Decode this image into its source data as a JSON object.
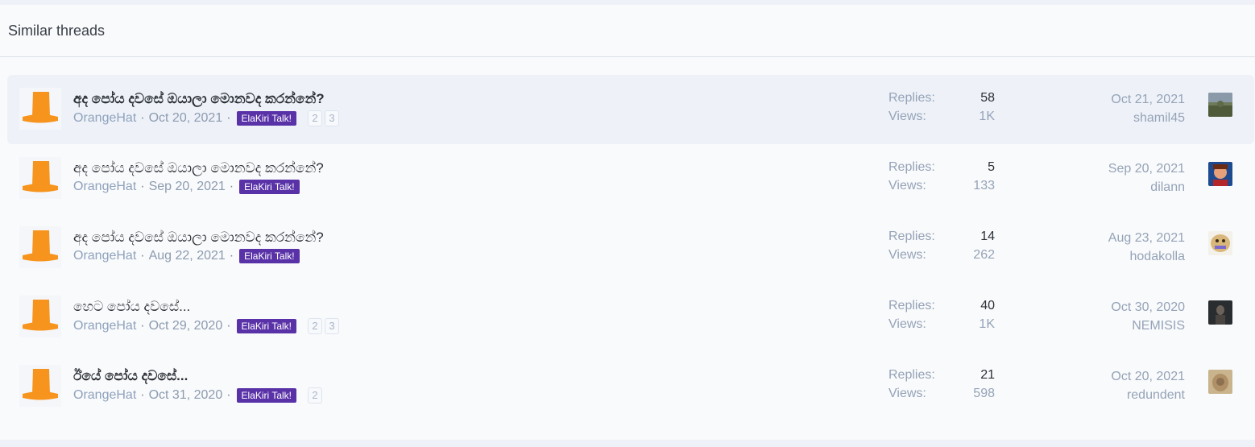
{
  "header": {
    "title": "Similar threads"
  },
  "labels": {
    "replies": "Replies:",
    "views": "Views:"
  },
  "colors": {
    "tag_bg": "#5a32a8",
    "hat": "#f7941d",
    "author": "#8fa2bd"
  },
  "threads": [
    {
      "title": "අද පෝය දවසේ ඔයාලා මොනවද කරන්නේ?",
      "author": "OrangeHat",
      "date": "Oct 20, 2021",
      "tag": "ElaKiri Talk!",
      "pages": [
        "2",
        "3"
      ],
      "replies": "58",
      "views": "1K",
      "last_date": "Oct 21, 2021",
      "last_user": "shamil45",
      "last_avatar_icon": "landscape-avatar"
    },
    {
      "title": "අද පෝය දවසේ ඔයාලා මොනවද කරන්නේ?",
      "author": "OrangeHat",
      "date": "Sep 20, 2021",
      "tag": "ElaKiri Talk!",
      "pages": [],
      "replies": "5",
      "views": "133",
      "last_date": "Sep 20, 2021",
      "last_user": "dilann",
      "last_avatar_icon": "cartoon-avatar"
    },
    {
      "title": "අද පෝය දවසේ ඔයාලා මොනවද කරන්නේ?",
      "author": "OrangeHat",
      "date": "Aug 22, 2021",
      "tag": "ElaKiri Talk!",
      "pages": [],
      "replies": "14",
      "views": "262",
      "last_date": "Aug 23, 2021",
      "last_user": "hodakolla",
      "last_avatar_icon": "face-avatar"
    },
    {
      "title": "හෙට පෝය දවසේ...",
      "author": "OrangeHat",
      "date": "Oct 29, 2020",
      "tag": "ElaKiri Talk!",
      "pages": [
        "2",
        "3"
      ],
      "replies": "40",
      "views": "1K",
      "last_date": "Oct 30, 2020",
      "last_user": "NEMISIS",
      "last_avatar_icon": "dark-figure-avatar"
    },
    {
      "title": "ඊයේ පෝය දවසේ...",
      "author": "OrangeHat",
      "date": "Oct 31, 2020",
      "tag": "ElaKiri Talk!",
      "pages": [
        "2"
      ],
      "replies": "21",
      "views": "598",
      "last_date": "Oct 20, 2021",
      "last_user": "redundent",
      "last_avatar_icon": "beige-avatar"
    }
  ]
}
